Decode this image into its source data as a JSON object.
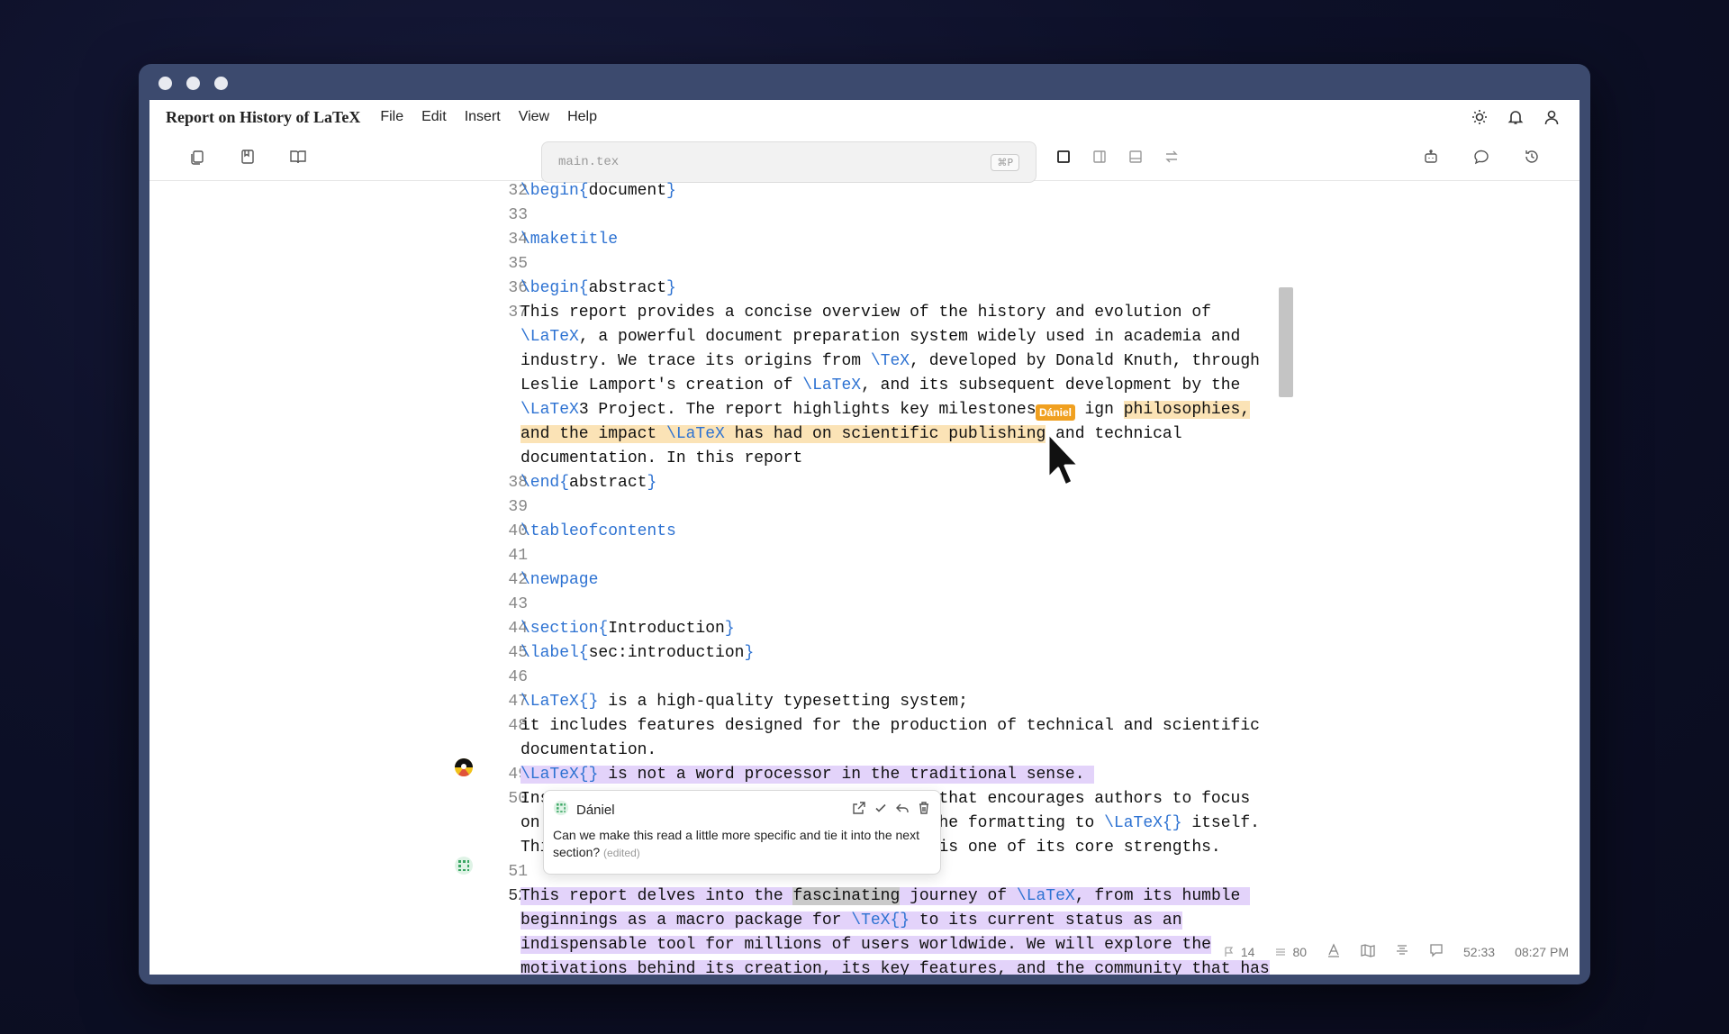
{
  "app": {
    "doc_title": "Report on History of LaTeX",
    "menu": [
      "File",
      "Edit",
      "Insert",
      "View",
      "Help"
    ]
  },
  "toolbar": {
    "search_placeholder": "main.tex",
    "search_shortcut": "⌘P"
  },
  "editor": {
    "lines": [
      {
        "n": "32",
        "segments": [
          {
            "t": "\\begin{",
            "c": "cmd"
          },
          {
            "t": "document"
          },
          {
            "t": "}",
            "c": "cmd"
          }
        ]
      },
      {
        "n": "33",
        "segments": []
      },
      {
        "n": "34",
        "segments": [
          {
            "t": "\\maketitle",
            "c": "cmd"
          }
        ]
      },
      {
        "n": "35",
        "segments": []
      },
      {
        "n": "36",
        "segments": [
          {
            "t": "\\begin{",
            "c": "cmd"
          },
          {
            "t": "abstract"
          },
          {
            "t": "}",
            "c": "cmd"
          }
        ]
      },
      {
        "n": "37",
        "segments": [
          {
            "t": "This report provides a concise overview of the history and evolution of"
          }
        ]
      },
      {
        "n": "",
        "segments": [
          {
            "t": "\\LaTeX",
            "c": "cmd"
          },
          {
            "t": ", a powerful document preparation system widely used in academia and"
          }
        ]
      },
      {
        "n": "",
        "segments": [
          {
            "t": "industry. We trace its origins from "
          },
          {
            "t": "\\TeX",
            "c": "cmd"
          },
          {
            "t": ", developed by Donald Knuth, through"
          }
        ]
      },
      {
        "n": "",
        "segments": [
          {
            "t": "Leslie Lamport's creation of "
          },
          {
            "t": "\\LaTeX",
            "c": "cmd"
          },
          {
            "t": ", and its subsequent development by the"
          }
        ]
      },
      {
        "n": "",
        "segments": [
          {
            "t": "\\LaTeX",
            "c": "cmd"
          },
          {
            "t": "3 Project. The report highlights key milestones"
          },
          {
            "t": "     ign "
          },
          {
            "t": "philosophies,",
            "h": "hl-orange"
          }
        ]
      },
      {
        "n": "",
        "segments": [
          {
            "t": "and the impact ",
            "h": "hl-orange"
          },
          {
            "t": "\\LaTeX",
            "c": "cmd",
            "h": "hl-orange"
          },
          {
            "t": " has had on scientific publishing",
            "h": "hl-orange"
          },
          {
            "t": " and technical"
          }
        ]
      },
      {
        "n": "",
        "segments": [
          {
            "t": "documentation. In this report"
          }
        ]
      },
      {
        "n": "38",
        "segments": [
          {
            "t": "\\end{",
            "c": "cmd"
          },
          {
            "t": "abstract"
          },
          {
            "t": "}",
            "c": "cmd"
          }
        ]
      },
      {
        "n": "39",
        "segments": []
      },
      {
        "n": "40",
        "segments": [
          {
            "t": "\\tableofcontents",
            "c": "cmd"
          }
        ]
      },
      {
        "n": "41",
        "segments": []
      },
      {
        "n": "42",
        "segments": [
          {
            "t": "\\newpage",
            "c": "cmd"
          }
        ]
      },
      {
        "n": "43",
        "segments": []
      },
      {
        "n": "44",
        "segments": [
          {
            "t": "\\section{",
            "c": "cmd"
          },
          {
            "t": "Introduction"
          },
          {
            "t": "}",
            "c": "cmd"
          }
        ]
      },
      {
        "n": "45",
        "segments": [
          {
            "t": "\\label{",
            "c": "cmd"
          },
          {
            "t": "sec:introduction"
          },
          {
            "t": "}",
            "c": "cmd"
          }
        ]
      },
      {
        "n": "46",
        "segments": []
      },
      {
        "n": "47",
        "segments": [
          {
            "t": "\\LaTeX{}",
            "c": "cmd"
          },
          {
            "t": " is a high-quality typesetting system;"
          }
        ]
      },
      {
        "n": "48",
        "segments": [
          {
            "t": "it includes features designed for the production of technical and scientific"
          }
        ]
      },
      {
        "n": "",
        "segments": [
          {
            "t": "documentation."
          }
        ]
      },
      {
        "n": "49",
        "segments": [
          {
            "t": "\\LaTeX{}",
            "c": "cmd",
            "h": "hl-purple"
          },
          {
            "t": " is not a word processor in the traditional sense. ",
            "h": "hl-purple"
          }
        ]
      },
      {
        "n": "50",
        "segments": [
          {
            "t": "Ins                                        that encourages authors to focus"
          }
        ]
      },
      {
        "n": "",
        "segments": [
          {
            "t": "on                                         he formatting to "
          },
          {
            "t": "\\LaTeX{}",
            "c": "cmd"
          },
          {
            "t": " itself."
          }
        ]
      },
      {
        "n": "",
        "segments": [
          {
            "t": "Thi                                        is one of its core strengths."
          }
        ]
      },
      {
        "n": "51",
        "segments": []
      },
      {
        "n": "52",
        "active": true,
        "segments": [
          {
            "t": "This report delves into the ",
            "h": "hl-purple"
          },
          {
            "t": "fascinating",
            "h": "hl-sel"
          },
          {
            "t": " journey of ",
            "h": "hl-purple"
          },
          {
            "t": "\\LaTeX",
            "c": "cmd",
            "h": "hl-purple"
          },
          {
            "t": ", from its humble ",
            "h": "hl-purple"
          }
        ]
      },
      {
        "n": "",
        "segments": [
          {
            "t": "beginnings as a macro package for ",
            "h": "hl-purple"
          },
          {
            "t": "\\TeX{}",
            "c": "cmd",
            "h": "hl-purple"
          },
          {
            "t": " to its current status as an",
            "h": "hl-purple"
          }
        ]
      },
      {
        "n": "",
        "segments": [
          {
            "t": "indispensable tool for millions of users worldwide. We will explore the",
            "h": "hl-purple"
          }
        ]
      },
      {
        "n": "",
        "segments": [
          {
            "t": "motivations behind its creation, its key features, and the community that has",
            "h": "hl-purple"
          }
        ]
      }
    ],
    "cursor_user": "Dániel"
  },
  "comment": {
    "author": "Dániel",
    "body": "Can we make this read a little more specific and tie it into the next section?",
    "edited": "(edited)"
  },
  "statusbar": {
    "count_a": "14",
    "count_b": "80",
    "position": "52:33",
    "time": "08:27 PM"
  }
}
